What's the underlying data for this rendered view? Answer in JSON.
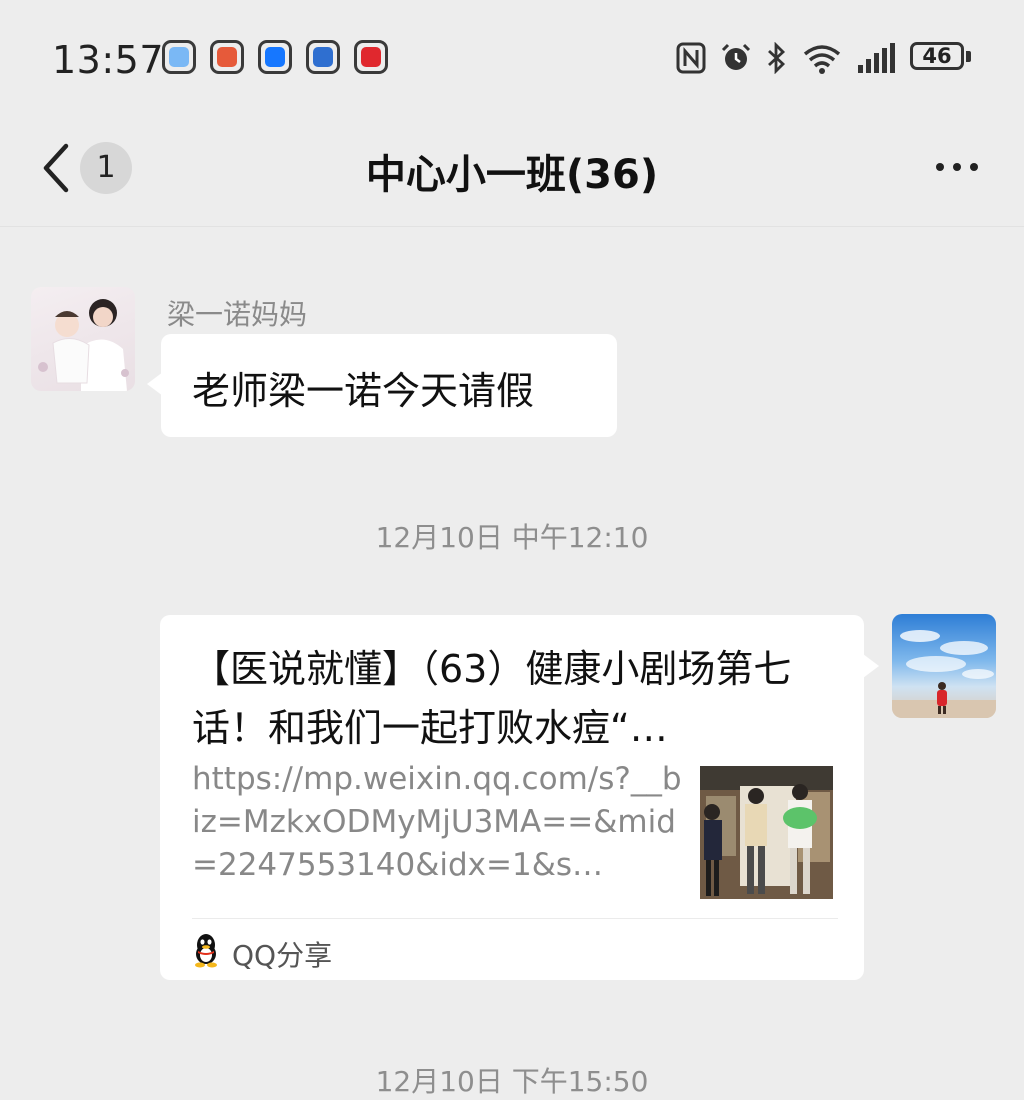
{
  "status_bar": {
    "time": "13:57",
    "battery": "46",
    "app_icons": [
      "chat-app-icon",
      "shopping-app-icon",
      "alipay-icon",
      "bank-app-icon",
      "card-app-icon"
    ],
    "system_icons": [
      "nfc-icon",
      "alarm-icon",
      "bluetooth-icon",
      "wifi-icon",
      "signal-icon",
      "battery-icon"
    ]
  },
  "nav": {
    "unread_count": "1",
    "title": "中心小一班(36)"
  },
  "messages": [
    {
      "sender": "梁一诺妈妈",
      "text": "老师梁一诺今天请假"
    }
  ],
  "timestamps": [
    "12月10日 中午12:10",
    "12月10日 下午15:50"
  ],
  "share_card": {
    "title": "【医说就懂】（63）健康小剧场第七话！和我们一起打败水痘“…",
    "description": "https://mp.weixin.qq.com/s?__biz=MzkxODMyMjU3MA==&mid=2247553140&idx=1&s…",
    "source": "QQ分享"
  },
  "colors": {
    "background": "#ededed",
    "bubble": "#ffffff",
    "accent_alipay": "#1677ff",
    "accent_red": "#e0282e"
  }
}
